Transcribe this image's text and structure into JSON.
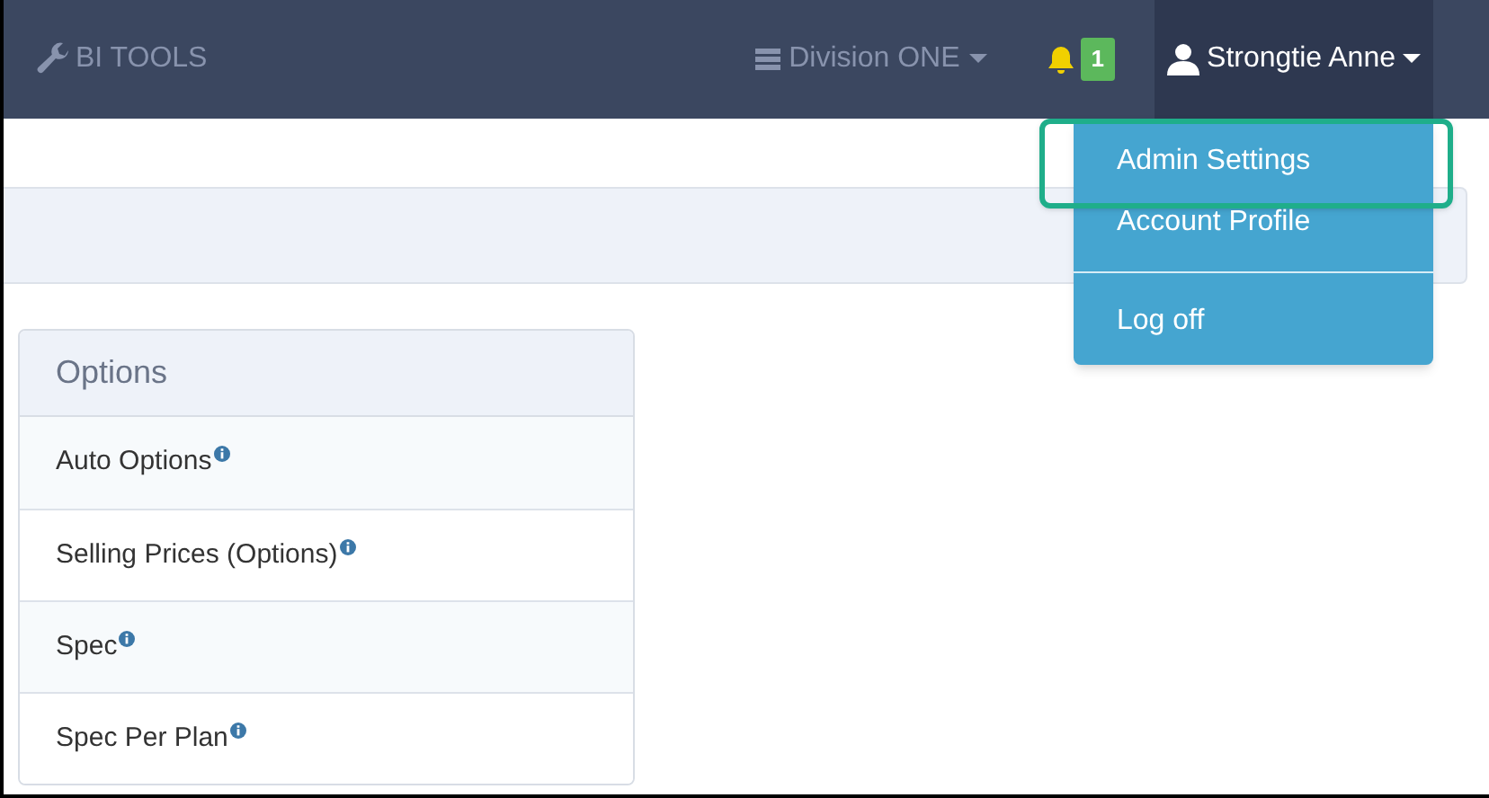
{
  "navbar": {
    "brand": "BI TOOLS",
    "division": "Division ONE",
    "notifications": "1",
    "user": "Strongtie Anne"
  },
  "user_menu": {
    "open": true,
    "items": [
      {
        "label": "Admin Settings",
        "highlighted": true,
        "divider_before": false
      },
      {
        "label": "Account Profile",
        "highlighted": false,
        "divider_before": false
      },
      {
        "label": "Log off",
        "highlighted": false,
        "divider_before": true
      }
    ]
  },
  "options_panel": {
    "title": "Options",
    "items": [
      {
        "label": "Auto Options",
        "info": true
      },
      {
        "label": "Selling Prices (Options)",
        "info": true
      },
      {
        "label": "Spec",
        "info": true
      },
      {
        "label": "Spec Per Plan",
        "info": true
      }
    ]
  }
}
